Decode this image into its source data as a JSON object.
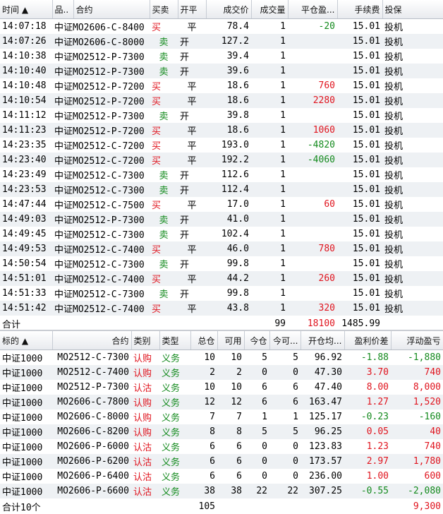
{
  "trades": {
    "columns": [
      "时间 ▲",
      "品..",
      "合约",
      "买卖",
      "开平",
      "成交价",
      "成交量",
      "平仓盈...",
      "手续费",
      "投保"
    ],
    "rows": [
      {
        "time": "14:07:18",
        "contract": "中证MO2606-C-8400",
        "side": "买",
        "oc": "平",
        "price": "78.4",
        "qty": "1",
        "pnl": "-20",
        "fee": "15.01",
        "hedge": "投机"
      },
      {
        "time": "14:07:26",
        "contract": "中证MO2606-C-8000",
        "side": "卖",
        "oc": "开",
        "price": "127.2",
        "qty": "1",
        "pnl": "",
        "fee": "15.01",
        "hedge": "投机"
      },
      {
        "time": "14:10:38",
        "contract": "中证MO2512-P-7300",
        "side": "卖",
        "oc": "开",
        "price": "39.4",
        "qty": "1",
        "pnl": "",
        "fee": "15.01",
        "hedge": "投机"
      },
      {
        "time": "14:10:40",
        "contract": "中证MO2512-P-7300",
        "side": "卖",
        "oc": "开",
        "price": "39.6",
        "qty": "1",
        "pnl": "",
        "fee": "15.01",
        "hedge": "投机"
      },
      {
        "time": "14:10:48",
        "contract": "中证MO2512-P-7200",
        "side": "买",
        "oc": "平",
        "price": "18.6",
        "qty": "1",
        "pnl": "760",
        "fee": "15.01",
        "hedge": "投机"
      },
      {
        "time": "14:10:54",
        "contract": "中证MO2512-P-7200",
        "side": "买",
        "oc": "平",
        "price": "18.6",
        "qty": "1",
        "pnl": "2280",
        "fee": "15.01",
        "hedge": "投机"
      },
      {
        "time": "14:11:12",
        "contract": "中证MO2512-P-7300",
        "side": "卖",
        "oc": "开",
        "price": "39.8",
        "qty": "1",
        "pnl": "",
        "fee": "15.01",
        "hedge": "投机"
      },
      {
        "time": "14:11:23",
        "contract": "中证MO2512-P-7200",
        "side": "买",
        "oc": "平",
        "price": "18.6",
        "qty": "1",
        "pnl": "1060",
        "fee": "15.01",
        "hedge": "投机"
      },
      {
        "time": "14:23:35",
        "contract": "中证MO2512-C-7200",
        "side": "买",
        "oc": "平",
        "price": "193.0",
        "qty": "1",
        "pnl": "-4820",
        "fee": "15.01",
        "hedge": "投机"
      },
      {
        "time": "14:23:40",
        "contract": "中证MO2512-C-7200",
        "side": "买",
        "oc": "平",
        "price": "192.2",
        "qty": "1",
        "pnl": "-4060",
        "fee": "15.01",
        "hedge": "投机"
      },
      {
        "time": "14:23:49",
        "contract": "中证MO2512-C-7300",
        "side": "卖",
        "oc": "开",
        "price": "112.6",
        "qty": "1",
        "pnl": "",
        "fee": "15.01",
        "hedge": "投机"
      },
      {
        "time": "14:23:53",
        "contract": "中证MO2512-C-7300",
        "side": "卖",
        "oc": "开",
        "price": "112.4",
        "qty": "1",
        "pnl": "",
        "fee": "15.01",
        "hedge": "投机"
      },
      {
        "time": "14:47:44",
        "contract": "中证MO2512-C-7500",
        "side": "买",
        "oc": "平",
        "price": "17.0",
        "qty": "1",
        "pnl": "60",
        "fee": "15.01",
        "hedge": "投机"
      },
      {
        "time": "14:49:03",
        "contract": "中证MO2512-P-7300",
        "side": "卖",
        "oc": "开",
        "price": "41.0",
        "qty": "1",
        "pnl": "",
        "fee": "15.01",
        "hedge": "投机"
      },
      {
        "time": "14:49:45",
        "contract": "中证MO2512-C-7300",
        "side": "卖",
        "oc": "开",
        "price": "102.4",
        "qty": "1",
        "pnl": "",
        "fee": "15.01",
        "hedge": "投机"
      },
      {
        "time": "14:49:53",
        "contract": "中证MO2512-C-7400",
        "side": "买",
        "oc": "平",
        "price": "46.0",
        "qty": "1",
        "pnl": "780",
        "fee": "15.01",
        "hedge": "投机"
      },
      {
        "time": "14:50:54",
        "contract": "中证MO2512-C-7300",
        "side": "卖",
        "oc": "开",
        "price": "99.8",
        "qty": "1",
        "pnl": "",
        "fee": "15.01",
        "hedge": "投机"
      },
      {
        "time": "14:51:01",
        "contract": "中证MO2512-C-7400",
        "side": "买",
        "oc": "平",
        "price": "44.2",
        "qty": "1",
        "pnl": "260",
        "fee": "15.01",
        "hedge": "投机"
      },
      {
        "time": "14:51:33",
        "contract": "中证MO2512-C-7300",
        "side": "卖",
        "oc": "开",
        "price": "99.8",
        "qty": "1",
        "pnl": "",
        "fee": "15.01",
        "hedge": "投机"
      },
      {
        "time": "14:51:42",
        "contract": "中证MO2512-C-7400",
        "side": "买",
        "oc": "平",
        "price": "43.8",
        "qty": "1",
        "pnl": "320",
        "fee": "15.01",
        "hedge": "投机"
      }
    ],
    "summary": {
      "label": "合计",
      "qty": "99",
      "pnl": "18100",
      "fee": "1485.99"
    }
  },
  "positions": {
    "columns": [
      "标的 ▲",
      "合约",
      "类别",
      "类型",
      "总仓",
      "可用",
      "今仓",
      "今可...",
      "开仓均...",
      "盈利价差",
      "浮动盈亏"
    ],
    "rows": [
      {
        "underlying": "中证1000",
        "contract": "MO2512-C-7300",
        "category": "认购",
        "type": "义务",
        "total": "10",
        "avail": "10",
        "today": "5",
        "today_avail": "5",
        "avg": "96.92",
        "spread": "-1.88",
        "float_pnl": "-1,880"
      },
      {
        "underlying": "中证1000",
        "contract": "MO2512-C-7400",
        "category": "认购",
        "type": "义务",
        "total": "2",
        "avail": "2",
        "today": "0",
        "today_avail": "0",
        "avg": "47.30",
        "spread": "3.70",
        "float_pnl": "740"
      },
      {
        "underlying": "中证1000",
        "contract": "MO2512-P-7300",
        "category": "认沽",
        "type": "义务",
        "total": "10",
        "avail": "10",
        "today": "6",
        "today_avail": "6",
        "avg": "47.40",
        "spread": "8.00",
        "float_pnl": "8,000"
      },
      {
        "underlying": "中证1000",
        "contract": "MO2606-C-7800",
        "category": "认购",
        "type": "义务",
        "total": "12",
        "avail": "12",
        "today": "6",
        "today_avail": "6",
        "avg": "163.47",
        "spread": "1.27",
        "float_pnl": "1,520"
      },
      {
        "underlying": "中证1000",
        "contract": "MO2606-C-8000",
        "category": "认购",
        "type": "义务",
        "total": "7",
        "avail": "7",
        "today": "1",
        "today_avail": "1",
        "avg": "125.17",
        "spread": "-0.23",
        "float_pnl": "-160"
      },
      {
        "underlying": "中证1000",
        "contract": "MO2606-C-8200",
        "category": "认购",
        "type": "义务",
        "total": "8",
        "avail": "8",
        "today": "5",
        "today_avail": "5",
        "avg": "96.25",
        "spread": "0.05",
        "float_pnl": "40"
      },
      {
        "underlying": "中证1000",
        "contract": "MO2606-P-6000",
        "category": "认沽",
        "type": "义务",
        "total": "6",
        "avail": "6",
        "today": "0",
        "today_avail": "0",
        "avg": "123.83",
        "spread": "1.23",
        "float_pnl": "740"
      },
      {
        "underlying": "中证1000",
        "contract": "MO2606-P-6200",
        "category": "认沽",
        "type": "义务",
        "total": "6",
        "avail": "6",
        "today": "0",
        "today_avail": "0",
        "avg": "173.57",
        "spread": "2.97",
        "float_pnl": "1,780"
      },
      {
        "underlying": "中证1000",
        "contract": "MO2606-P-6400",
        "category": "认沽",
        "type": "义务",
        "total": "6",
        "avail": "6",
        "today": "0",
        "today_avail": "0",
        "avg": "236.00",
        "spread": "1.00",
        "float_pnl": "600"
      },
      {
        "underlying": "中证1000",
        "contract": "MO2606-P-6600",
        "category": "认沽",
        "type": "义务",
        "total": "38",
        "avail": "38",
        "today": "22",
        "today_avail": "22",
        "avg": "307.25",
        "spread": "-0.55",
        "float_pnl": "-2,080"
      }
    ],
    "summary": {
      "label": "合计10个",
      "total": "105",
      "float_pnl": "9,300"
    }
  },
  "colors": {
    "buy": "#e0141e",
    "sell": "#138a1d",
    "profit": "#e0141e",
    "loss": "#138a1d"
  }
}
